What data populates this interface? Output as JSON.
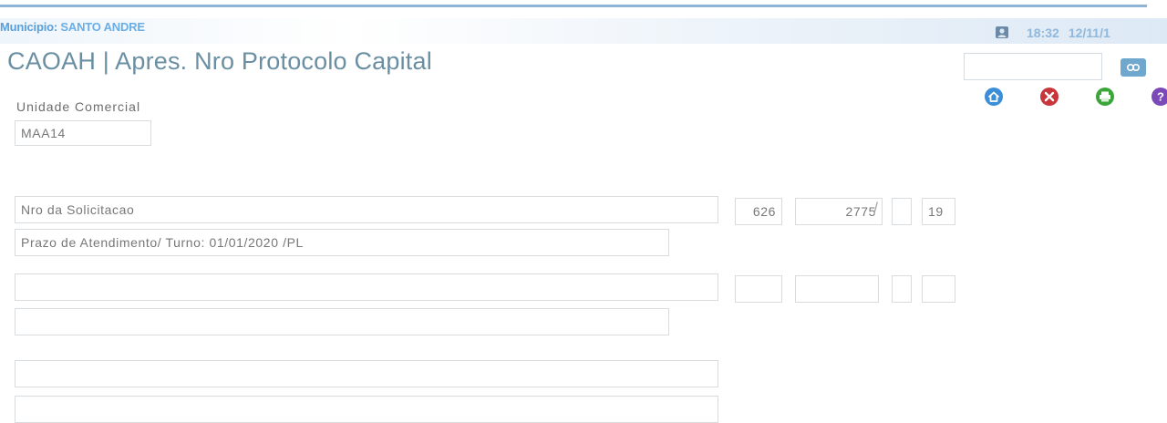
{
  "header": {
    "municipio_label": "Municipio:",
    "municipio_value": "SANTO ANDRE",
    "time": "18:32",
    "date": "12/11/1",
    "user_icon": "user-icon"
  },
  "page": {
    "title": "CAOAH | Apres. Nro Protocolo Capital"
  },
  "toolbar": {
    "search_value": "",
    "search_button_icon": "search-icon",
    "actions": [
      {
        "name": "home",
        "icon": "home-icon",
        "color": "#3c8ed6"
      },
      {
        "name": "close",
        "icon": "close-icon",
        "color": "#c8353a"
      },
      {
        "name": "print",
        "icon": "print-icon",
        "color": "#3aa63a"
      },
      {
        "name": "help",
        "icon": "help-icon",
        "color": "#7c4ab8"
      }
    ]
  },
  "form": {
    "unidade_label": "Unidade Comercial",
    "unidade_value": "MAA14",
    "row1": {
      "description": "Nro da Solicitacao",
      "code": "626",
      "number": "2775",
      "separator": "/",
      "year": "19"
    },
    "row1_prazo": "Prazo de Atendimento/ Turno: 01/01/2020 /PL",
    "row2": {
      "description": "",
      "code": "",
      "number": "",
      "separator": "",
      "year": ""
    },
    "row2_prazo": "",
    "extra1": "",
    "extra2": ""
  },
  "colors": {
    "title": "#6a8fa3",
    "header_text": "#5aa0dc",
    "field_border": "#d9dcde"
  }
}
